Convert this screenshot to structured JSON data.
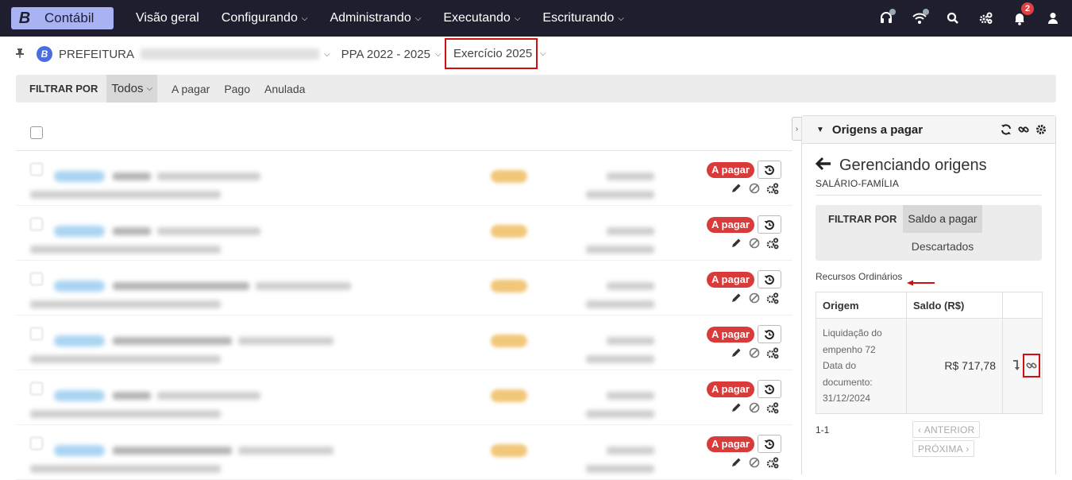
{
  "topnav": {
    "brand_letter": "B",
    "brand_name": "Contábil",
    "items": [
      {
        "label": "Visão geral",
        "chevron": false
      },
      {
        "label": "Configurando",
        "chevron": true
      },
      {
        "label": "Administrando",
        "chevron": true
      },
      {
        "label": "Executando",
        "chevron": true
      },
      {
        "label": "Escriturando",
        "chevron": true
      }
    ],
    "notification_count": "2"
  },
  "breadcrumb": {
    "org_letter": "B",
    "org_prefix": "PREFEITURA",
    "ppa": "PPA 2022 - 2025",
    "exercicio": "Exercício 2025"
  },
  "filter": {
    "label": "FILTRAR POR",
    "selected": "Todos",
    "options": [
      "A pagar",
      "Pago",
      "Anulada"
    ]
  },
  "rows": [
    {
      "status": "A pagar"
    },
    {
      "status": "A pagar"
    },
    {
      "status": "A pagar"
    },
    {
      "status": "A pagar"
    },
    {
      "status": "A pagar"
    },
    {
      "status": "A pagar"
    }
  ],
  "panel": {
    "title": "Origens a pagar",
    "manage_title": "Gerenciando origens",
    "manage_subtitle": "SALÁRIO-FAMÍLIA",
    "filter_label": "FILTRAR POR",
    "filter_selected": "Saldo a pagar",
    "filter_other": "Descartados",
    "recursos": "Recursos Ordinários",
    "table": {
      "headers": [
        "Origem",
        "Saldo (R$)",
        ""
      ],
      "rows": [
        {
          "origem_lines": [
            "Liquidação do",
            "empenho 72",
            "Data do",
            "documento:",
            "31/12/2024"
          ],
          "saldo": "R$ 717,78"
        }
      ]
    },
    "pager": {
      "count": "1-1",
      "prev": "ANTERIOR",
      "next": "PRÓXIMA"
    }
  }
}
